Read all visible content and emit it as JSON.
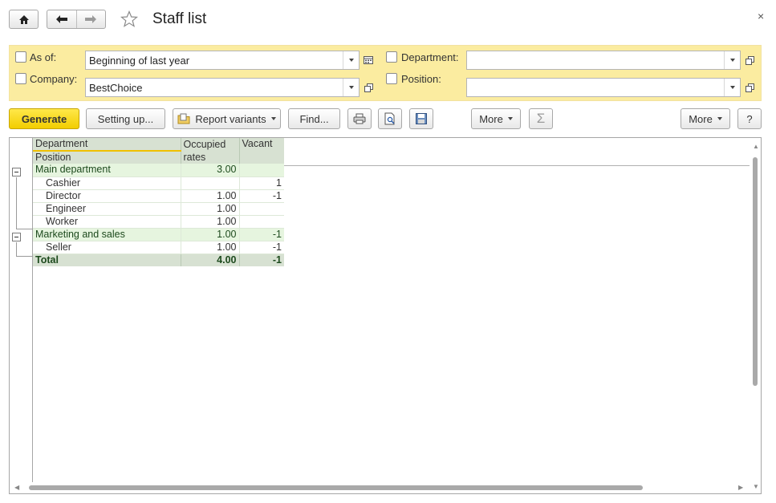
{
  "window": {
    "title": "Staff list",
    "home_icon": "home-icon",
    "back_icon": "arrow-left-icon",
    "forward_icon": "arrow-right-icon",
    "favorite_icon": "star-icon",
    "close_glyph": "×"
  },
  "filters": {
    "as_of": {
      "label": "As of:",
      "checked": false,
      "value": "Beginning of last year"
    },
    "company": {
      "label": "Company:",
      "checked": false,
      "value": "BestChoice"
    },
    "department": {
      "label": "Department:",
      "checked": false,
      "value": ""
    },
    "position": {
      "label": "Position:",
      "checked": false,
      "value": ""
    }
  },
  "toolbar": {
    "generate": "Generate",
    "setting_up": "Setting up...",
    "report_variants": "Report variants",
    "find": "Find...",
    "more_left": "More",
    "sum_glyph": "Σ",
    "more_right": "More",
    "help": "?"
  },
  "report": {
    "headers": {
      "dept": "Department",
      "pos": "Position",
      "occupied": "Occupied rates",
      "vacant": "Vacant"
    },
    "groups": [
      {
        "name": "Main department",
        "occupied": "3.00",
        "vacant": "",
        "rows": [
          {
            "name": "Cashier",
            "occupied": "",
            "vacant": "1"
          },
          {
            "name": "Director",
            "occupied": "1.00",
            "vacant": "-1"
          },
          {
            "name": "Engineer",
            "occupied": "1.00",
            "vacant": ""
          },
          {
            "name": "Worker",
            "occupied": "1.00",
            "vacant": ""
          }
        ]
      },
      {
        "name": "Marketing and sales",
        "occupied": "1.00",
        "vacant": "-1",
        "rows": [
          {
            "name": "Seller",
            "occupied": "1.00",
            "vacant": "-1"
          }
        ]
      }
    ],
    "total": {
      "label": "Total",
      "occupied": "4.00",
      "vacant": "-1"
    }
  },
  "colors": {
    "filter_bg": "#fbeca0",
    "primary_button": "#f5d60a",
    "header_bg": "#d7e1d2",
    "group_bg": "#e6f5df"
  }
}
